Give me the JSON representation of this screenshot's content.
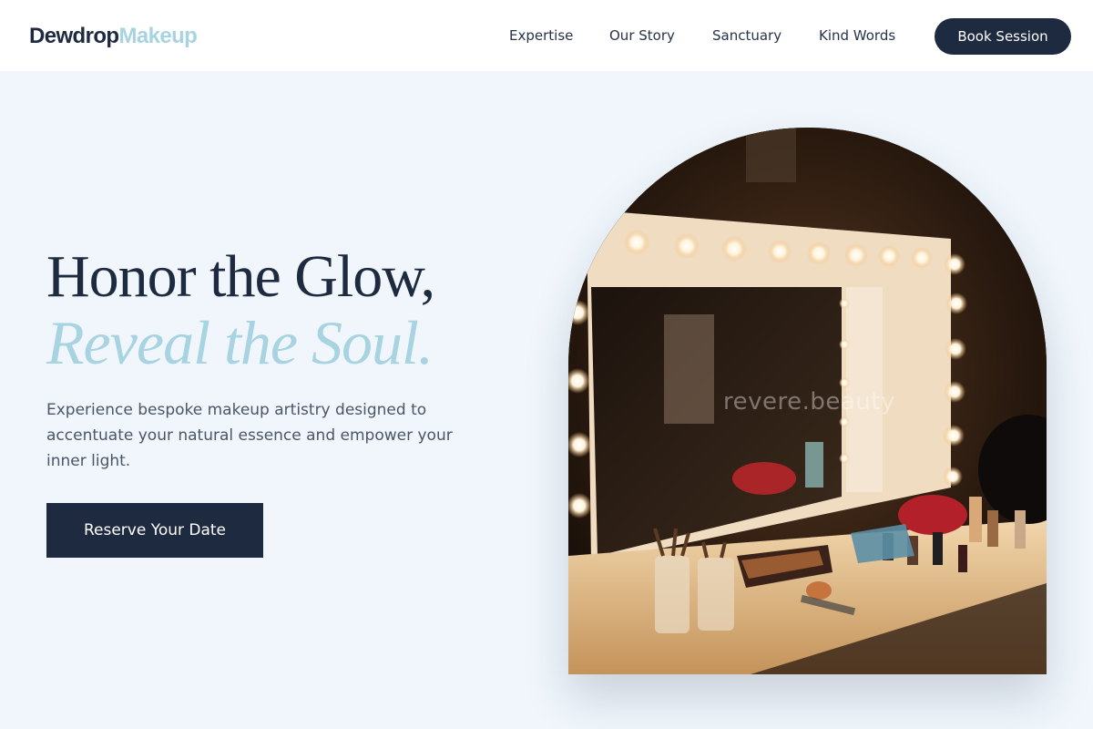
{
  "brand": {
    "name_part1": "Dewdrop",
    "name_part2": "Makeup"
  },
  "nav": {
    "items": [
      {
        "label": "Expertise"
      },
      {
        "label": "Our Story"
      },
      {
        "label": "Sanctuary"
      },
      {
        "label": "Kind Words"
      }
    ],
    "cta_label": "Book Session"
  },
  "hero": {
    "title_line1": "Honor the Glow,",
    "title_line2": "Reveal the Soul.",
    "subtitle": "Experience bespoke makeup artistry designed to accentuate your natural essence and empower your inner light.",
    "cta_label": "Reserve Your Date"
  },
  "image": {
    "watermark": "revere.beauty"
  },
  "colors": {
    "navy": "#1d2a3f",
    "accent_blue": "#a8d3e1",
    "page_bg": "#f0f6fc"
  }
}
